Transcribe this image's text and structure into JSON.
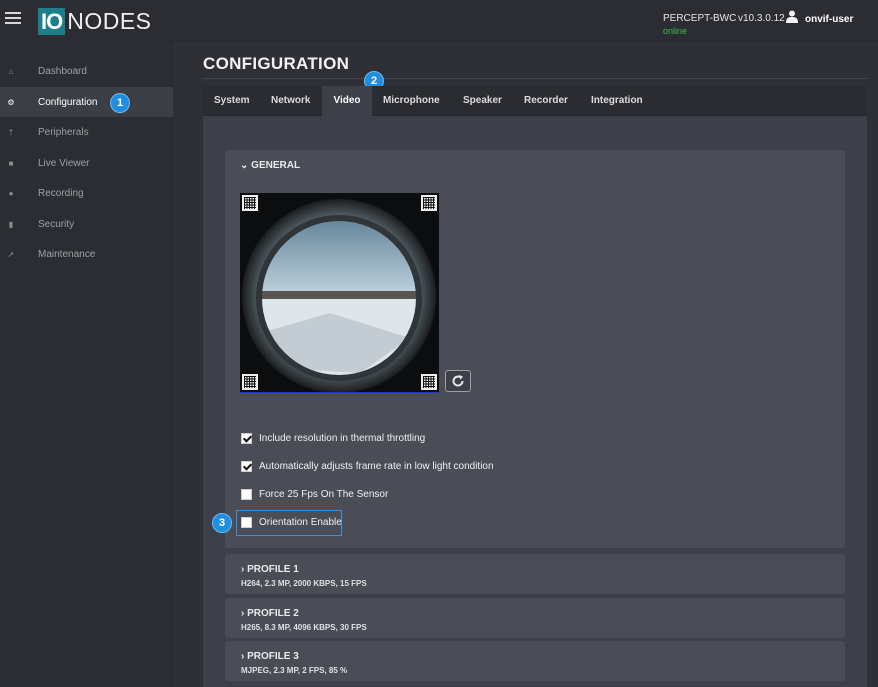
{
  "header": {
    "logo_io": "IO",
    "logo_nodes": "NODES",
    "device_name": "PERCEPT-BWC",
    "device_status": "online",
    "version": "v10.3.0.12",
    "user": "onvif-user"
  },
  "sidebar": {
    "items": [
      {
        "label": "Dashboard",
        "icon": "home-icon"
      },
      {
        "label": "Configuration",
        "icon": "gear-icon"
      },
      {
        "label": "Peripherals",
        "icon": "microphone-icon"
      },
      {
        "label": "Live Viewer",
        "icon": "video-camera-icon"
      },
      {
        "label": "Recording",
        "icon": "record-icon"
      },
      {
        "label": "Security",
        "icon": "lock-icon"
      },
      {
        "label": "Maintenance",
        "icon": "wrench-icon"
      }
    ],
    "active": "Configuration"
  },
  "callouts": {
    "one": "1",
    "two": "2",
    "three": "3"
  },
  "main": {
    "title": "CONFIGURATION",
    "tabs": [
      "System",
      "Network",
      "Video",
      "Microphone",
      "Speaker",
      "Recorder",
      "Integration"
    ],
    "active_tab": "Video",
    "general": {
      "heading": "GENERAL",
      "options": [
        {
          "label": "Include resolution in thermal throttling",
          "checked": true
        },
        {
          "label": "Automatically adjusts frame rate in low light condition",
          "checked": true
        },
        {
          "label": "Force 25 Fps On The Sensor",
          "checked": false
        },
        {
          "label": "Orientation Enable",
          "checked": false
        }
      ]
    },
    "profiles": [
      {
        "title": "PROFILE 1",
        "summary": "H264, 2.3 MP, 2000 KBPS, 15 FPS"
      },
      {
        "title": "PROFILE 2",
        "summary": "H265, 8.3 MP, 4096 KBPS, 30 FPS"
      },
      {
        "title": "PROFILE 3",
        "summary": "MJPEG, 2.3 MP, 2 FPS, 85 %"
      }
    ]
  },
  "colors": {
    "accent": "#1f8ee0",
    "online": "#3dbb4a",
    "logo_bg": "#1e7f8c"
  }
}
